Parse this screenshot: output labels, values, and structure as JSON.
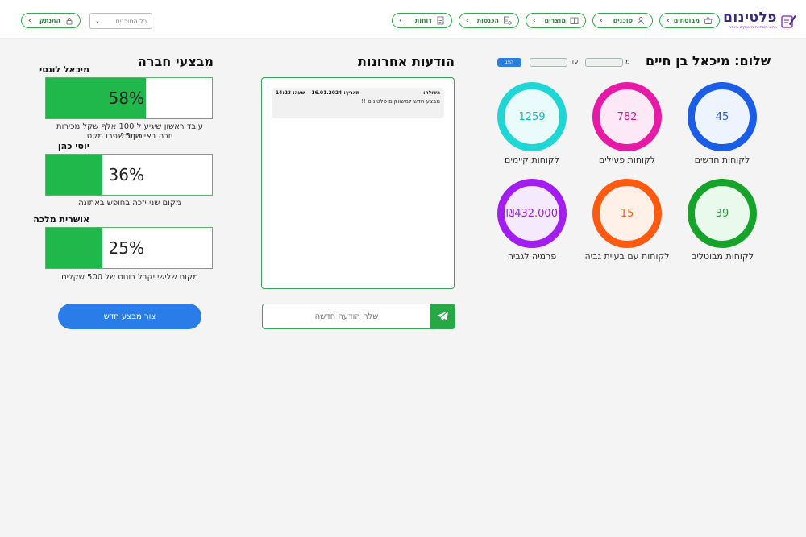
{
  "brand": {
    "name": "פלטינום",
    "tagline": "ניהוג תשתיות השווקים ביותר"
  },
  "nav": [
    {
      "label": "מבוטחים",
      "icon": "basket-icon",
      "key": "insured"
    },
    {
      "label": "סוכנים",
      "icon": "users-icon",
      "key": "agents"
    },
    {
      "label": "מוצרים",
      "icon": "box-icon",
      "key": "products"
    },
    {
      "label": "הכנסות",
      "icon": "coins-icon",
      "key": "income"
    },
    {
      "label": "דוחות",
      "icon": "report-icon",
      "key": "reports"
    }
  ],
  "agent_filter": {
    "selected": "כל הסוכנים"
  },
  "logout": {
    "label": "התנתק",
    "icon": "lock-icon"
  },
  "greeting": "שלום: מיכאל בן חיים",
  "date_filter": {
    "from_label": "מ",
    "to_label": "עד",
    "from_value": "",
    "to_value": "",
    "show_label": "הצג"
  },
  "stats": [
    {
      "key": "new",
      "value": "45",
      "label": "לקוחות חדשים",
      "color": "#1a5ee8",
      "bg": "#eef4ff",
      "text": "#1a5ee8"
    },
    {
      "key": "active",
      "value": "782",
      "label": "לקוחות פעילים",
      "color": "#e61aa6",
      "bg": "#fde8f6",
      "text": "#d01e8f"
    },
    {
      "key": "existing",
      "value": "1259",
      "label": "לקוחות קיימים",
      "color": "#1fd6d6",
      "bg": "#e9fbfb",
      "text": "#19b8c4"
    },
    {
      "key": "canceled",
      "value": "39",
      "label": "לקוחות מבוטלים",
      "color": "#16a32a",
      "bg": "#e9f9ec",
      "text": "#27a140"
    },
    {
      "key": "collection",
      "value": "15",
      "label": "לקוחות עם בעיית גביה",
      "color": "#ff5a10",
      "bg": "#fff0e8",
      "text": "#ff5a10"
    },
    {
      "key": "premium",
      "value": "₪432.000",
      "label": "פרמיה לגביה",
      "color": "#a31cf0",
      "bg": "#f5eafd",
      "text": "#9a22e0"
    }
  ],
  "messages": {
    "title": "הודעות אחרונות",
    "items": [
      {
        "sender": "השולח:",
        "date": "תאריך: 16.01.2024",
        "time": "שעה: 14:23",
        "text": "מבצע חדש למשווקים פלטינום !!"
      }
    ],
    "input_placeholder": "שלח הודעה חדשה"
  },
  "performance": {
    "title": "מבצעי חברה",
    "items": [
      {
        "name": "מיכאל לוגסי",
        "percent": 58,
        "percent_label": "58%",
        "desc_lines": [
          "עובד ראשון שיגיע ל 100 אלף שקל מכירות החודש",
          "יזכה באייפון 15 פרו מקס"
        ]
      },
      {
        "name": "יוסי כהן",
        "percent": 36,
        "percent_label": "36%",
        "desc_lines": [
          "מקום שני יזכה בחופש באתונה"
        ]
      },
      {
        "name": "אושרית מלכה",
        "percent": 25,
        "percent_label": "25%",
        "desc_lines": [
          "מקום שלישי יקבל בונוס של 500 שקלים"
        ]
      }
    ],
    "create_button": "צור מבצע חדש"
  }
}
